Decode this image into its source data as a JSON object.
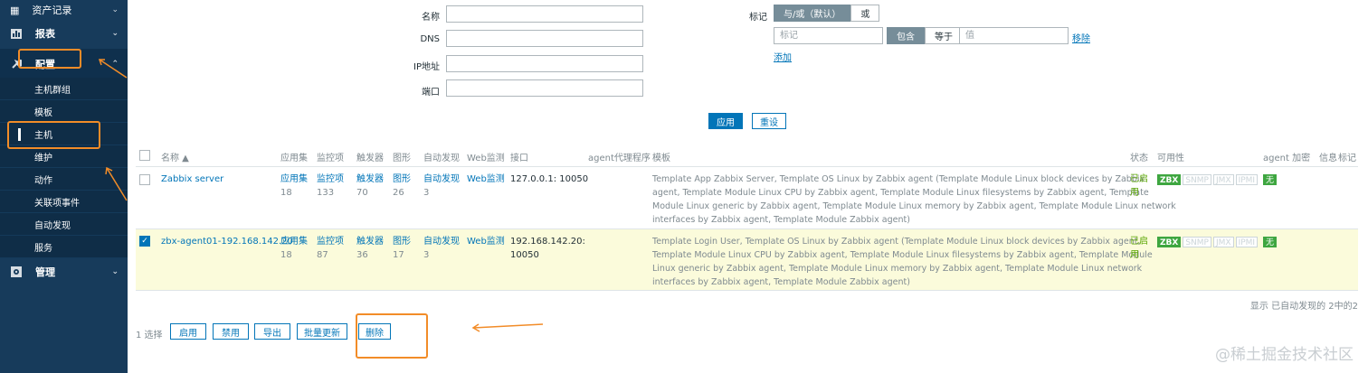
{
  "sidebar": {
    "top_item": "资产记录",
    "sections": [
      {
        "label": "报表",
        "icon": "bar-chart-icon"
      },
      {
        "label": "配置",
        "icon": "wrench-icon"
      },
      {
        "label": "管理",
        "icon": "gear-icon"
      }
    ],
    "config_items": [
      "主机群组",
      "模板",
      "主机",
      "维护",
      "动作",
      "关联项事件",
      "自动发现",
      "服务"
    ]
  },
  "filter": {
    "name_label": "名称",
    "dns_label": "DNS",
    "ip_label": "IP地址",
    "port_label": "端口",
    "tag_label": "标记",
    "tag_and_or": "与/或（默认）",
    "tag_or": "或",
    "tag_name_placeholder": "标记",
    "op_contains": "包含",
    "op_equals": "等于",
    "value_placeholder": "值",
    "remove": "移除",
    "add": "添加",
    "apply": "应用",
    "reset": "重设"
  },
  "table": {
    "headers": [
      "名称 ▲",
      "应用集",
      "监控项",
      "触发器",
      "图形",
      "自动发现",
      "Web监测",
      "接口",
      "agent代理程序",
      "模板",
      "状态",
      "可用性",
      "agent 加密",
      "信息",
      "标记"
    ],
    "rows": [
      {
        "name": "Zabbix server",
        "apps_label": "应用集",
        "apps_count": "18",
        "items_label": "监控项",
        "items_count": "133",
        "triggers_label": "触发器",
        "triggers_count": "70",
        "graphs_label": "图形",
        "graphs_count": "26",
        "discovery_label": "自动发现",
        "discovery_count": "3",
        "web": "Web监测",
        "interface": "127.0.0.1: 10050",
        "templates_lines": [
          "Template App Zabbix Server, Template OS Linux by Zabbix agent (Template Module Linux block devices by Zabbix",
          "agent, Template Module Linux CPU by Zabbix agent, Template Module Linux filesystems by Zabbix agent, Template",
          "Module Linux generic by Zabbix agent, Template Module Linux memory by Zabbix agent, Template Module Linux network",
          "interfaces by Zabbix agent, Template Module Zabbix agent)"
        ],
        "status": "已启用",
        "checked": false
      },
      {
        "name": "zbx-agent01-192.168.142.20",
        "apps_label": "应用集",
        "apps_count": "18",
        "items_label": "监控项",
        "items_count": "87",
        "triggers_label": "触发器",
        "triggers_count": "36",
        "graphs_label": "图形",
        "graphs_count": "17",
        "discovery_label": "自动发现",
        "discovery_count": "3",
        "web": "Web监测",
        "interface": "192.168.142.20: 10050",
        "templates_lines": [
          "Template Login User, Template OS Linux by Zabbix agent (Template Module Linux block devices by Zabbix agent,",
          "Template Module Linux CPU by Zabbix agent, Template Module Linux filesystems by Zabbix agent, Template Module",
          "Linux generic by Zabbix agent, Template Module Linux memory by Zabbix agent, Template Module Linux network",
          "interfaces by Zabbix agent, Template Module Zabbix agent)"
        ],
        "status": "已启用",
        "checked": true
      }
    ],
    "availability": [
      "ZBX",
      "SNMP",
      "JMX",
      "IPMI"
    ],
    "encryption": "无",
    "footer": "显示 已自动发现的 2中的2"
  },
  "actions": {
    "selected": "1 选择",
    "buttons": [
      "启用",
      "禁用",
      "导出",
      "批量更新",
      "删除"
    ]
  },
  "watermark": "@稀土掘金技术社区",
  "colors": {
    "accent": "#0275b8",
    "sidebar": "#173b5b",
    "highlight": "#f28c28",
    "selected_row": "#fbfbdb",
    "green": "#3ea640"
  }
}
